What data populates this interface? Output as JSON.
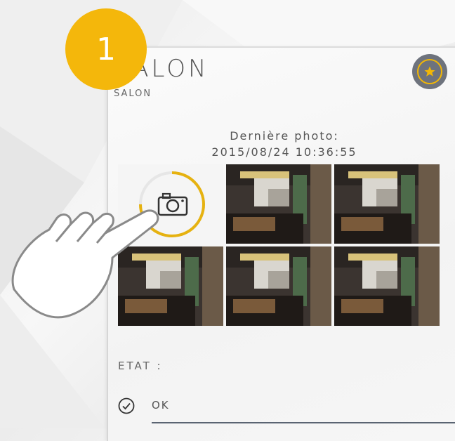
{
  "room": {
    "title": "SALON",
    "subtitle": "SALON"
  },
  "favorite": {
    "icon": "star-icon",
    "accent_color": "#f2b705",
    "button_color": "#6e737d"
  },
  "last_photo": {
    "label": "Dernière photo:",
    "timestamp": "2015/08/24 10:36:55"
  },
  "capture": {
    "icon": "camera-icon",
    "ring_color": "#e6b210"
  },
  "photos": [
    {
      "icon": "room-photo"
    },
    {
      "icon": "room-photo"
    },
    {
      "icon": "room-photo"
    },
    {
      "icon": "room-photo"
    },
    {
      "icon": "room-photo"
    }
  ],
  "step_badge": {
    "number": "1",
    "color": "#f4b70b"
  },
  "status": {
    "heading": "ETAT :",
    "value": "OK",
    "icon": "check-circle-icon"
  }
}
